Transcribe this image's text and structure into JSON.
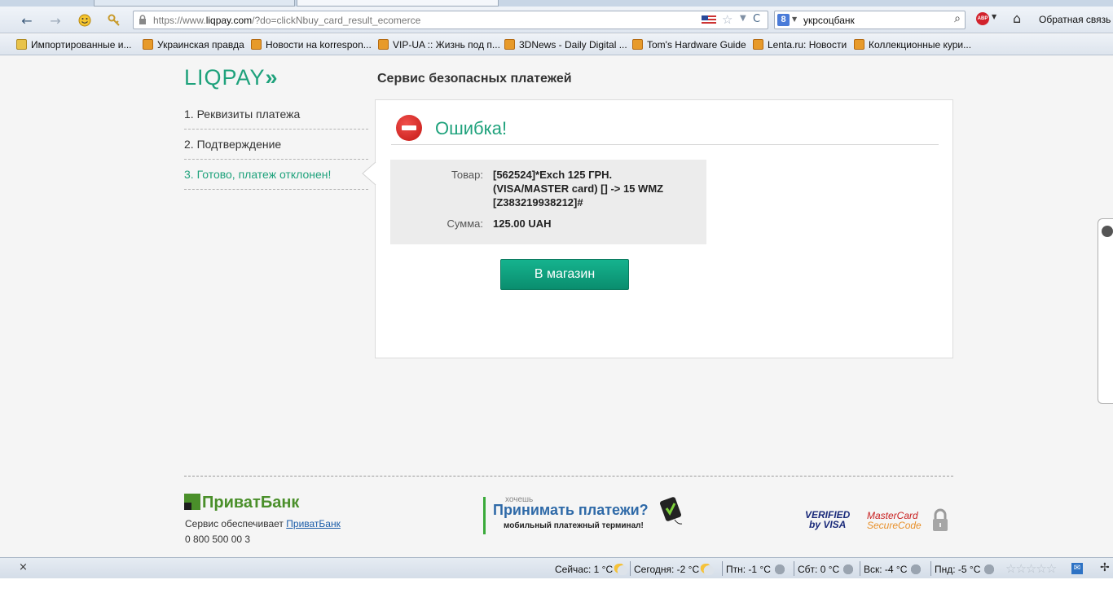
{
  "browser": {
    "url_prefix": "https://www.",
    "url_domain": "liqpay.com",
    "url_path": "/?do=clickNbuy_card_result_ecomerce",
    "search_engine_letter": "8",
    "search_query": "укрсоцбанк",
    "abp_label": "ABP",
    "feedback_label": "Обратная связь"
  },
  "bookmarks": [
    {
      "label": "Импортированные и...",
      "icon": "folder-icon"
    },
    {
      "label": "Украинская правда",
      "icon": "rss-icon"
    },
    {
      "label": "Новости на korrespon...",
      "icon": "rss-icon"
    },
    {
      "label": "VIP-UA :: Жизнь под п...",
      "icon": "rss-icon"
    },
    {
      "label": "3DNews - Daily Digital ...",
      "icon": "rss-icon"
    },
    {
      "label": "Tom's Hardware Guide",
      "icon": "rss-icon"
    },
    {
      "label": "Lenta.ru: Новости",
      "icon": "rss-icon"
    },
    {
      "label": "Коллекционные кури...",
      "icon": "rss-icon"
    }
  ],
  "header": {
    "logo_text": "LIQPAY",
    "logo_arrows": "»",
    "service_title": "Сервис безопасных платежей"
  },
  "steps": [
    {
      "label": "1. Реквизиты платежа",
      "active": false
    },
    {
      "label": "2. Подтверждение",
      "active": false
    },
    {
      "label": "3. Готово, платеж отклонен!",
      "active": true
    }
  ],
  "result": {
    "title": "Ошибка!",
    "product_label": "Товар:",
    "product_lines": [
      "[562524]*Exch 125 ГРН.",
      "(VISA/MASTER card) [] -> 15 WMZ",
      "[Z383219938212]#"
    ],
    "amount_label": "Сумма:",
    "amount_value": "125.00",
    "amount_currency": "UAH",
    "shop_button": "В магазин"
  },
  "footer": {
    "bank_logo": "ПриватБанк",
    "service_prefix": "Сервис обеспечивает",
    "service_link": "ПриватБанк",
    "phone": "0 800 500 00 3",
    "terminal_small": "хочешь",
    "terminal_big": "Принимать платежи?",
    "terminal_sub": "мобильный платежный терминал!",
    "visa_line1": "VERIFIED",
    "visa_line2": "by VISA",
    "mc_line1": "MasterCard",
    "mc_line2": "SecureCode"
  },
  "statusbar": {
    "close_glyph": "×",
    "weather": [
      {
        "text": "Сейчас: 1 °C",
        "icon": "sun-cloud-icon"
      },
      {
        "text": "Сегодня: -2 °C",
        "icon": "sun-cloud-icon"
      },
      {
        "text": "Птн: -1 °C",
        "icon": "snow-cloud-icon"
      },
      {
        "text": "Сбт: 0 °C",
        "icon": "snow-cloud-icon"
      },
      {
        "text": "Вск: -4 °C",
        "icon": "snow-cloud-icon"
      },
      {
        "text": "Пнд: -5 °C",
        "icon": "snow-cloud-icon"
      }
    ],
    "rating_stars": "☆☆☆☆☆"
  }
}
